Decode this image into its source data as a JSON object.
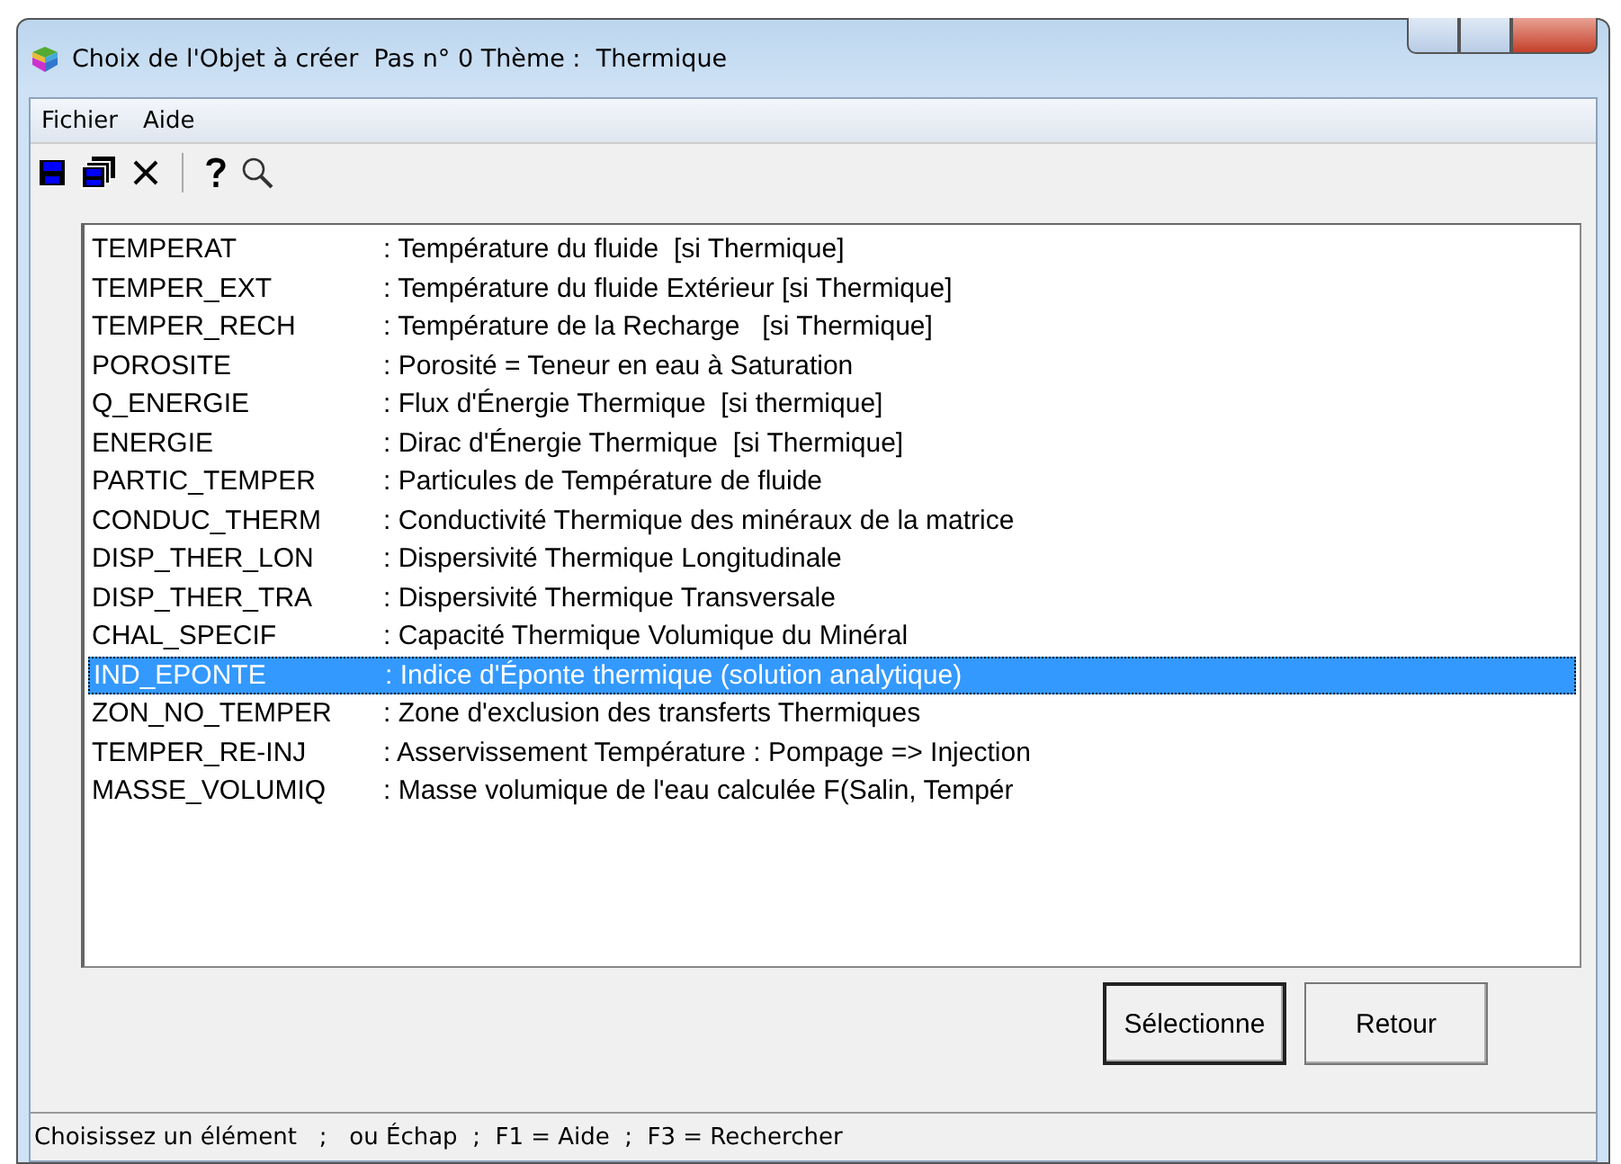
{
  "window": {
    "title": "Choix de l'Objet à créer  Pas n° 0 Thème :  Thermique"
  },
  "menu": [
    "Fichier",
    "Aide"
  ],
  "toolbar": [
    {
      "kind": "save"
    },
    {
      "kind": "save-all"
    },
    {
      "kind": "delete"
    },
    {
      "kind": "separator"
    },
    {
      "kind": "help"
    },
    {
      "kind": "search"
    }
  ],
  "list": [
    {
      "code": "TEMPERAT",
      "description": ": Température du fluide  [si Thermique]",
      "selected": false
    },
    {
      "code": "TEMPER_EXT",
      "description": ": Température du fluide Extérieur [si Thermique]",
      "selected": false
    },
    {
      "code": "TEMPER_RECH",
      "description": ": Température de la Recharge   [si Thermique]",
      "selected": false
    },
    {
      "code": "POROSITE",
      "description": ": Porosité = Teneur en eau à Saturation",
      "selected": false
    },
    {
      "code": "Q_ENERGIE",
      "description": ": Flux d'Énergie Thermique  [si thermique]",
      "selected": false
    },
    {
      "code": "ENERGIE",
      "description": ": Dirac d'Énergie Thermique  [si Thermique]",
      "selected": false
    },
    {
      "code": "PARTIC_TEMPER",
      "description": ": Particules de Température de fluide",
      "selected": false
    },
    {
      "code": "CONDUC_THERM",
      "description": ": Conductivité Thermique des minéraux de la matrice",
      "selected": false
    },
    {
      "code": "DISP_THER_LON",
      "description": ": Dispersivité Thermique Longitudinale",
      "selected": false
    },
    {
      "code": "DISP_THER_TRA",
      "description": ": Dispersivité Thermique Transversale",
      "selected": false
    },
    {
      "code": "CHAL_SPECIF",
      "description": ": Capacité Thermique Volumique du Minéral",
      "selected": false
    },
    {
      "code": "IND_EPONTE",
      "description": ": Indice d'Éponte thermique (solution analytique)",
      "selected": true
    },
    {
      "code": "ZON_NO_TEMPER",
      "description": ": Zone d'exclusion des transferts Thermiques",
      "selected": false
    },
    {
      "code": "TEMPER_RE-INJ",
      "description": ": Asservissement Température : Pompage => Injection",
      "selected": false
    },
    {
      "code": "MASSE_VOLUMIQ",
      "description": ": Masse volumique de l'eau calculée F(Salin, Tempér",
      "selected": false
    }
  ],
  "buttons": [
    {
      "label": "Sélectionne",
      "default": true
    },
    {
      "label": "Retour",
      "default": false
    }
  ],
  "status_bar": "Choisissez un élément   ;   ou Échap  ;  F1 = Aide  ;  F3 = Rechercher"
}
